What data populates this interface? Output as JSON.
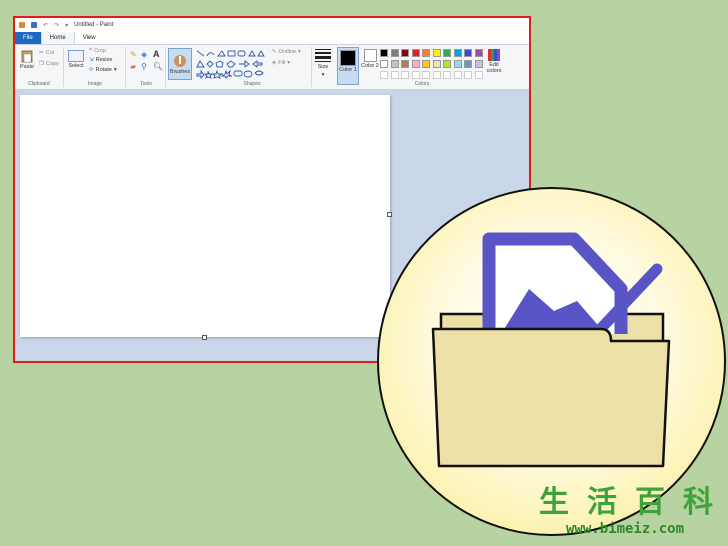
{
  "titlebar": {
    "title": "Untitled - Paint"
  },
  "tabs": [
    {
      "label": "File"
    },
    {
      "label": "Home"
    },
    {
      "label": "View"
    }
  ],
  "ribbon": {
    "clipboard": {
      "paste": "Paste",
      "cut": "Cut",
      "copy": "Copy",
      "group": "Clipboard"
    },
    "image": {
      "select": "Select",
      "crop": "Crop",
      "resize": "Resize",
      "rotate": "Rotate",
      "group": "Image"
    },
    "tools": {
      "group": "Tools",
      "text_tool": "A"
    },
    "brushes": {
      "label": "Brushes"
    },
    "shapes": {
      "outline": "Outline",
      "fill": "Fill",
      "group": "Shapes"
    },
    "size": {
      "label": "Size"
    },
    "colors": {
      "color1": "Color 1",
      "color2": "Color 2",
      "edit": "Edit colors",
      "group": "Colors",
      "palette_row1": [
        "#000000",
        "#7f7f7f",
        "#880015",
        "#ed1c24",
        "#ff7f27",
        "#fff200",
        "#22b14c",
        "#00a2e8",
        "#3f48cc",
        "#a349a4"
      ],
      "palette_row2": [
        "#ffffff",
        "#c3c3c3",
        "#b97a57",
        "#ffaec9",
        "#ffc90e",
        "#efe4b0",
        "#b5e61d",
        "#99d9ea",
        "#7092be",
        "#c8bfe7"
      ]
    }
  },
  "watermark": {
    "chars": [
      "生",
      "活",
      "百",
      "科"
    ],
    "url": "www.bimeiz.com"
  },
  "icon": {
    "name": "open-image-folder",
    "frame_color": "#5a55c6",
    "folder_color": "#ede0a6"
  }
}
